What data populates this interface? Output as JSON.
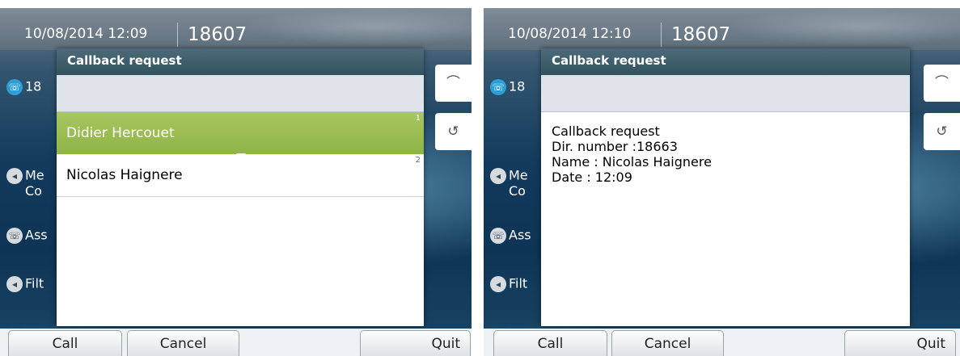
{
  "screens": [
    {
      "datetime": "10/08/2014 12:09",
      "extension": "18607",
      "left_lines": [
        "18",
        "Me",
        "Co",
        "Ass",
        "Filt"
      ],
      "dialog": {
        "title": "Callback request",
        "items": [
          {
            "index": "1",
            "name": "Didier Hercouet",
            "selected": true
          },
          {
            "index": "2",
            "name": "Nicolas Haignere",
            "selected": false
          }
        ]
      },
      "softkeys": [
        "Call",
        "Cancel",
        "Quit"
      ]
    },
    {
      "datetime": "10/08/2014 12:10",
      "extension": "18607",
      "left_lines": [
        "18",
        "Me",
        "Co",
        "Ass",
        "Filt"
      ],
      "dialog": {
        "title": "Callback request",
        "detail": [
          "Callback request",
          "Dir. number :18663",
          "Name : Nicolas Haignere",
          "Date : 12:09"
        ]
      },
      "softkeys": [
        "Call",
        "Cancel",
        "Quit"
      ]
    }
  ],
  "icons": {
    "handset": "handset-icon",
    "redial": "redial-icon",
    "messages": "message-icon",
    "filter": "filter-icon"
  },
  "colors": {
    "selection": "#9dbf55",
    "title_bar": "#3f5f6b",
    "background": "#123a5c"
  }
}
